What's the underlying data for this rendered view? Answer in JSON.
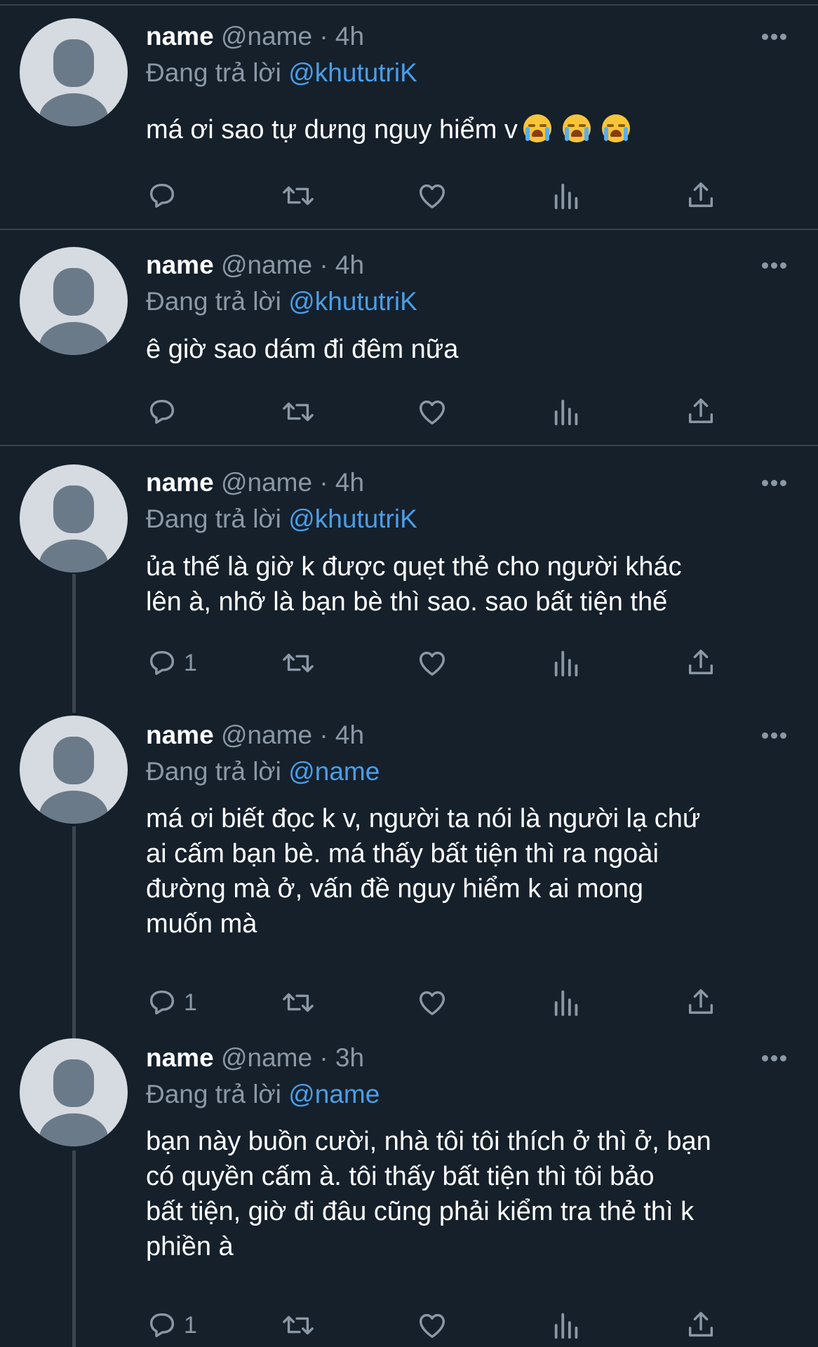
{
  "theme": {
    "background": "#15202b",
    "divider": "#38444d",
    "text": "#ffffff",
    "muted": "#8b98a5",
    "mention": "#4a9ee8"
  },
  "icons": {
    "reply": "reply-icon",
    "retweet": "retweet-icon",
    "like": "heart-icon",
    "views": "analytics-icon",
    "share": "share-icon",
    "more": "more-icon"
  },
  "tweets": [
    {
      "name": "name",
      "meta": "@name · 4h",
      "reply_prefix": "Đang trả lời ",
      "reply_to": "@khututriK",
      "text": "má ơi sao tự dưng nguy hiểm v",
      "emoji": "loudly-crying-face",
      "emoji_count": 3,
      "reply_count": ""
    },
    {
      "name": "name",
      "meta": "@name · 4h",
      "reply_prefix": "Đang trả lời ",
      "reply_to": "@khututriK",
      "text": "ê giờ sao dám đi đêm nữa",
      "reply_count": ""
    },
    {
      "name": "name",
      "meta": "@name · 4h",
      "reply_prefix": "Đang trả lời ",
      "reply_to": "@khututriK",
      "text": "ủa thế là giờ k được quẹt thẻ cho người khác\nlên à, nhỡ là bạn bè thì sao. sao bất tiện thế",
      "reply_count": "1"
    },
    {
      "name": "name",
      "meta": "@name · 4h",
      "reply_prefix": "Đang trả lời ",
      "reply_to": "@name",
      "text": "má ơi biết đọc k v, người ta nói là người lạ chứ\nai cấm bạn bè. má thấy bất tiện thì ra ngoài\nđường mà ở, vấn đề nguy hiểm k ai mong\nmuốn mà",
      "reply_count": "1"
    },
    {
      "name": "name",
      "meta": "@name · 3h",
      "reply_prefix": "Đang trả lời ",
      "reply_to": "@name",
      "text": "bạn này buồn cười, nhà tôi tôi thích ở thì ở, bạn\ncó quyền cấm à. tôi thấy bất tiện thì tôi bảo\nbất tiện, giờ đi đâu cũng phải kiểm tra thẻ thì k\nphiền à",
      "reply_count": "1"
    }
  ]
}
